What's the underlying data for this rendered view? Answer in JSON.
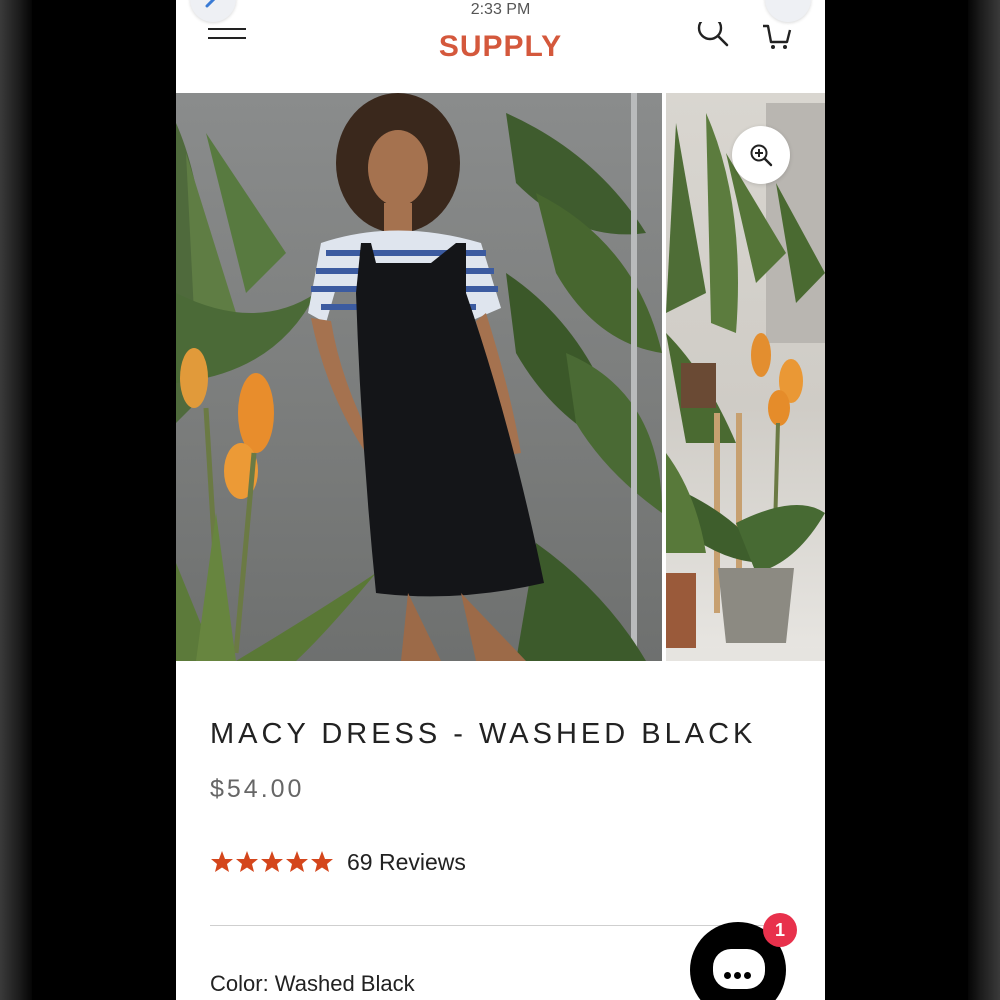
{
  "status": {
    "time": "2:33 PM"
  },
  "header": {
    "logo": "SUPPLY"
  },
  "product": {
    "title": "MACY DRESS - WASHED BLACK",
    "price": "$54.00",
    "rating": 5,
    "reviews_label": "69 Reviews",
    "color_label": "Color: Washed Black"
  },
  "chat": {
    "badge_count": "1"
  },
  "colors": {
    "brand": "#d4583c",
    "star": "#d4461c",
    "badge": "#e8314c"
  }
}
